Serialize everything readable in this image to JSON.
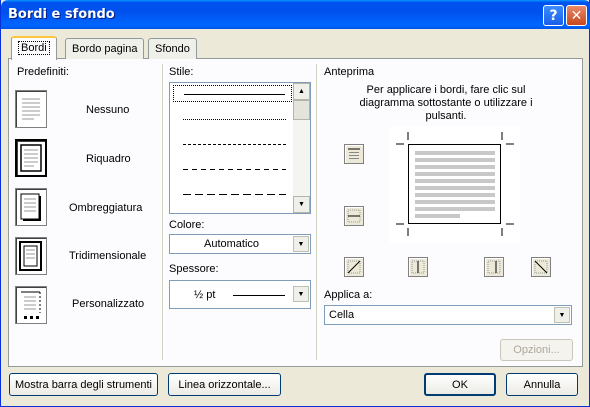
{
  "window": {
    "title": "Bordi e sfondo"
  },
  "tabs": [
    {
      "label": "Bordi",
      "active": true
    },
    {
      "label": "Bordo pagina",
      "active": false
    },
    {
      "label": "Sfondo",
      "active": false
    }
  ],
  "presets": {
    "heading": "Predefiniti:",
    "items": [
      {
        "label": "Nessuno",
        "icon": "border-none-icon"
      },
      {
        "label": "Riquadro",
        "icon": "border-box-icon",
        "selected": true
      },
      {
        "label": "Ombreggiatura",
        "icon": "border-shadow-icon"
      },
      {
        "label": "Tridimensionale",
        "icon": "border-3d-icon"
      },
      {
        "label": "Personalizzato",
        "icon": "border-custom-icon"
      }
    ]
  },
  "style_section": {
    "label": "Stile:",
    "line_styles": [
      "solid",
      "dotted",
      "dashed-small",
      "dashed",
      "dash-dot",
      "dash-long"
    ]
  },
  "color_section": {
    "label": "Colore:",
    "value": "Automatico"
  },
  "width_section": {
    "label": "Spessore:",
    "value": "½ pt"
  },
  "preview_section": {
    "label": "Anteprima",
    "instructions": "Per applicare i bordi, fare clic sul diagramma sottostante o utilizzare i pulsanti.",
    "border_buttons": [
      "border-top-icon",
      "border-middle-horizontal-icon",
      "border-diagonal-up-icon",
      "border-left-icon",
      "border-middle-vertical-icon",
      "border-right-icon",
      "border-diagonal-down-icon"
    ]
  },
  "apply_to": {
    "label": "Applica a:",
    "value": "Cella"
  },
  "buttons": {
    "options": "Opzioni...",
    "show_toolbar": "Mostra barra degli strumenti",
    "horizontal_line": "Linea orizzontale...",
    "ok": "OK",
    "cancel": "Annulla"
  },
  "colors": {
    "title_bar": "#0054e3",
    "face": "#ece9d8",
    "tab_highlight": "#ffc83c"
  }
}
